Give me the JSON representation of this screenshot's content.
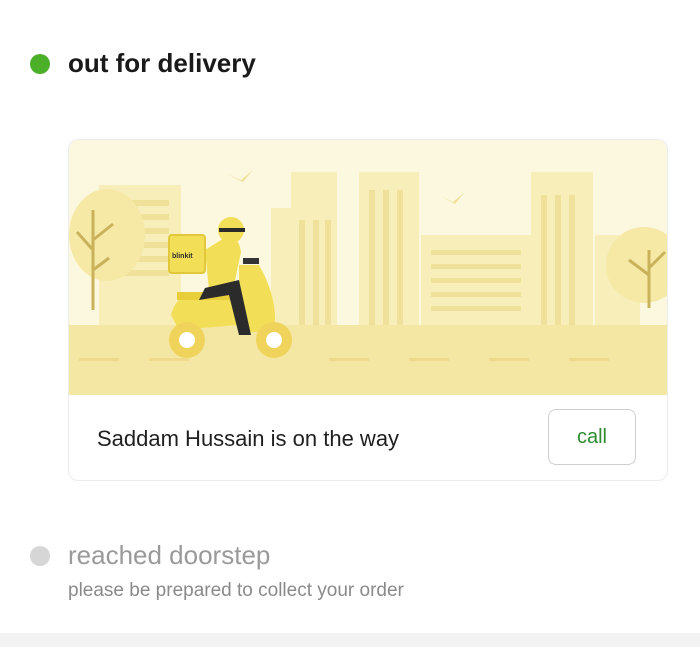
{
  "steps": {
    "out_for_delivery": {
      "title": "out for delivery",
      "status": "active"
    },
    "reached_doorstep": {
      "title": "reached doorstep",
      "subtitle": "please be prepared to collect your order",
      "status": "pending"
    }
  },
  "card": {
    "rider_message": "Saddam Hussain is on the way",
    "call_label": "call",
    "bag_brand": "blinkit"
  },
  "colors": {
    "active_dot": "#4caf28",
    "inactive_dot": "#d6d6d6",
    "call_text": "#2e8b2e",
    "illustration_yellow": "#f2df57"
  },
  "icons": [
    "status-dot-active",
    "status-dot-inactive",
    "delivery-scooter-illustration"
  ]
}
